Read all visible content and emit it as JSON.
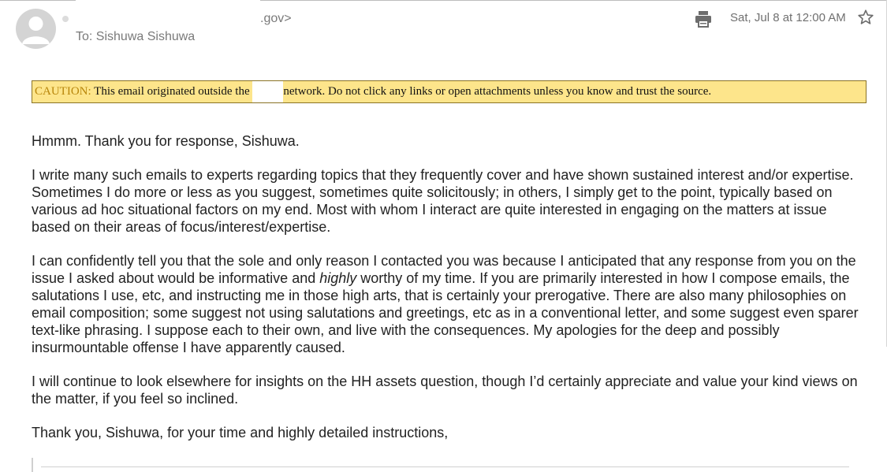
{
  "header": {
    "sender_domain": ".gov>",
    "to_line": "To: Sishuwa Sishuwa",
    "date": "Sat, Jul 8 at 12:00 AM",
    "icons": [
      "avatar-icon",
      "print-icon",
      "star-icon"
    ]
  },
  "caution": {
    "label": "CAUTION:",
    "text_before": " This email originated outside the ",
    "text_after": "network. Do not click any links or open attachments unless you know and trust the source.",
    "background": "#fde58b",
    "label_color": "#b8860b"
  },
  "message": {
    "p1": "Hmmm. Thank you for response, Sishuwa.",
    "p2": "I write many such emails to experts regarding topics that they frequently cover and have shown sustained interest and/or expertise.  Sometimes I do more or less as you suggest, sometimes quite solicitously; in others, I simply get to the point, typically based on various ad hoc situational factors on my end.  Most with whom I interact are quite interested in engaging on the matters at issue based on their areas of focus/interest/expertise.",
    "p3_a": "I can confidently tell you that the sole and only reason I contacted you was because I anticipated that any response from you on the issue I asked about would be informative and ",
    "p3_em": "highly",
    "p3_b": " worthy of my time. If you are primarily interested in how I compose emails, the salutations I use, etc, and instructing me in those high arts, that is certainly your prerogative. There are also many philosophies on email composition; some suggest not using salutations and greetings, etc as in a conventional letter, and some suggest even sparer text-like phrasing.  I suppose each to their own, and live with the consequences.  My apologies for the deep and possibly insurmountable offense I have apparently caused.",
    "p4": "I will continue to look elsewhere for insights on the HH assets question, though I’d certainly appreciate and value your kind views on the matter, if you feel so inclined.",
    "p5": "Thank you, Sishuwa, for your time and highly detailed instructions,"
  }
}
